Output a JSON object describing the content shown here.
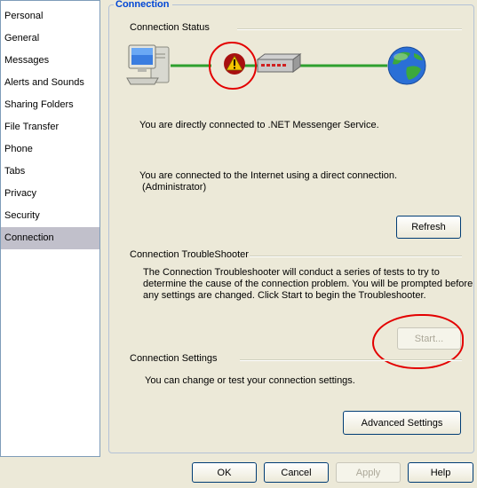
{
  "sidebar": {
    "items": [
      {
        "label": "Personal",
        "selected": false
      },
      {
        "label": "General",
        "selected": false
      },
      {
        "label": "Messages",
        "selected": false
      },
      {
        "label": "Alerts and Sounds",
        "selected": false
      },
      {
        "label": "Sharing Folders",
        "selected": false
      },
      {
        "label": "File Transfer",
        "selected": false
      },
      {
        "label": "Phone",
        "selected": false
      },
      {
        "label": "Tabs",
        "selected": false
      },
      {
        "label": "Privacy",
        "selected": false
      },
      {
        "label": "Security",
        "selected": false
      },
      {
        "label": "Connection",
        "selected": true
      }
    ]
  },
  "panel": {
    "title": "Connection",
    "status": {
      "heading": "Connection Status",
      "line1": "You are directly connected to .NET Messenger Service.",
      "line2": "You are connected to the Internet using a direct connection.",
      "line3": "(Administrator)",
      "refresh_label": "Refresh",
      "icons": [
        "computer-icon",
        "warning-icon",
        "router-icon",
        "globe-icon"
      ]
    },
    "troubleshooter": {
      "heading": "Connection TroubleShooter",
      "line1": "The Connection Troubleshooter will conduct a series of tests to try to",
      "line2": "determine the cause of the connection problem. You will be prompted before",
      "line3": "any settings are changed. Click Start to begin the Troubleshooter.",
      "start_label": "Start..."
    },
    "settings": {
      "heading": "Connection Settings",
      "text": "You can change or test your connection settings.",
      "advanced_label": "Advanced Settings"
    }
  },
  "footer": {
    "ok_label": "OK",
    "cancel_label": "Cancel",
    "apply_label": "Apply",
    "help_label": "Help"
  },
  "colors": {
    "panel_title": "#0046d5",
    "selected_item": "#c1c0cb",
    "connection_line": "#2ea02e",
    "annotation": "#e30000"
  }
}
